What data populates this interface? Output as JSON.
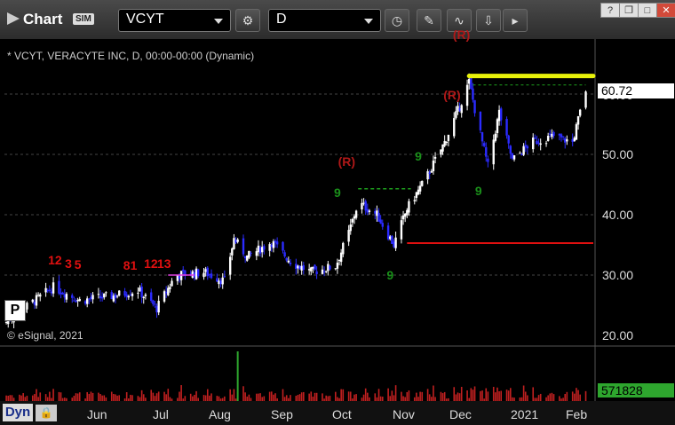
{
  "toolbar": {
    "title": "Chart",
    "sim_badge": "SIM",
    "symbol_value": "VCYT",
    "interval_value": "D"
  },
  "chart": {
    "header_text": "* VCYT, VERACYTE INC, D, 00:00-00:00 (Dynamic)",
    "copyright": "© eSignal, 2021",
    "last_price_label": "60.72",
    "volume_label": "571828",
    "footer_left": "Dyn",
    "p_marker": "P",
    "y_ticks": [
      "60.00",
      "50.00",
      "40.00",
      "30.00",
      "20.00"
    ],
    "x_ticks": [
      "Jun",
      "Jul",
      "Aug",
      "Sep",
      "Oct",
      "Nov",
      "Dec",
      "2021",
      "Feb"
    ],
    "colors": {
      "background": "#000000",
      "up_candle": "#ffffff",
      "down_candle": "#2b2bff",
      "resistance": "#e8f20a",
      "support": "#e01010",
      "dashed_green": "#1d9e1d",
      "volume": "#c02020",
      "setup_red": "#e01010",
      "setup_green": "#1a8f1a"
    }
  },
  "chart_data": {
    "type": "candlestick",
    "title": "VCYT, VERACYTE INC, D",
    "ylim": [
      20,
      64
    ],
    "resistance_level": 63,
    "support_level": 35.3,
    "last_price": 60.72,
    "last_volume": 571828,
    "annotations": [
      {
        "text": "(R)",
        "date": "2020-10-05",
        "price": 48.5
      },
      {
        "text": "(R)",
        "date": "2020-11-30",
        "price": 59.5
      },
      {
        "text": "(R)",
        "date": "2020-12-05",
        "price": 69.5
      }
    ],
    "setup_marks": [
      {
        "text": "12",
        "date": "2020-05-01",
        "price": 32.3
      },
      {
        "text": "3",
        "date": "2020-05-10",
        "price": 31.8
      },
      {
        "text": "5",
        "date": "2020-05-15",
        "price": 31.6
      },
      {
        "text": "81",
        "date": "2020-06-10",
        "price": 31.5
      },
      {
        "text": "12",
        "date": "2020-06-21",
        "price": 31.8
      },
      {
        "text": "13",
        "date": "2020-06-28",
        "price": 31.8
      },
      {
        "text": "9",
        "date": "2020-09-30",
        "price": 43.5
      },
      {
        "text": "9",
        "date": "2020-10-28",
        "price": 29.8
      },
      {
        "text": "9",
        "date": "2020-11-12",
        "price": 49.5
      },
      {
        "text": "9",
        "date": "2020-12-14",
        "price": 43.8
      }
    ]
  }
}
